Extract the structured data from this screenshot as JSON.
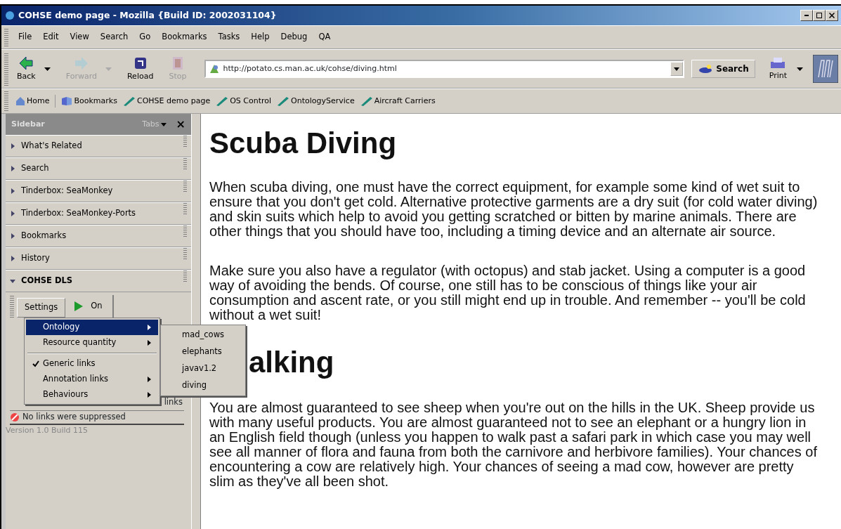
{
  "window": {
    "title": "COHSE demo page - Mozilla {Build ID: 2002031104}"
  },
  "menu_bar": [
    "File",
    "Edit",
    "View",
    "Search",
    "Go",
    "Bookmarks",
    "Tasks",
    "Help",
    "Debug",
    "QA"
  ],
  "toolbar": {
    "buttons": [
      {
        "label": "Back",
        "kind": "back",
        "disabled": false,
        "dropdown": true
      },
      {
        "label": "Forward",
        "kind": "forward",
        "disabled": true,
        "dropdown": true
      },
      {
        "label": "Reload",
        "kind": "reload",
        "disabled": false,
        "dropdown": false
      },
      {
        "label": "Stop",
        "kind": "stop",
        "disabled": true,
        "dropdown": false
      }
    ],
    "url": "http://potato.cs.man.ac.uk/cohse/diving.html",
    "search_button": "Search",
    "print_button": "Print"
  },
  "bookmarks_bar": [
    {
      "label": "Home",
      "kind": "home"
    },
    {
      "label": "Bookmarks",
      "kind": "bookmarks"
    },
    {
      "label": "COHSE demo page",
      "kind": "link"
    },
    {
      "label": "OS Control",
      "kind": "link"
    },
    {
      "label": "OntologyService",
      "kind": "link"
    },
    {
      "label": "Aircraft Carriers",
      "kind": "link"
    }
  ],
  "sidebar": {
    "title": "Sidebar",
    "tabs_label": "Tabs",
    "close": "×",
    "panels": [
      {
        "label": "What's Related",
        "expanded": false
      },
      {
        "label": "Search",
        "expanded": false
      },
      {
        "label": "Tinderbox: SeaMonkey",
        "expanded": false
      },
      {
        "label": "Tinderbox: SeaMonkey-Ports",
        "expanded": false
      },
      {
        "label": "Bookmarks",
        "expanded": false
      },
      {
        "label": "History",
        "expanded": false
      },
      {
        "label": "COHSE DLS",
        "expanded": true
      }
    ],
    "dls": {
      "settings_button": "Settings",
      "on_button": "On",
      "hidden_row_text": "links",
      "status": "No links were suppressed",
      "version": "Version 1.0 Build 115"
    }
  },
  "context_menu": {
    "items": [
      {
        "label": "Ontology",
        "kind": "submenu",
        "selected": true,
        "checked": false
      },
      {
        "label": "Resource quantity",
        "kind": "submenu",
        "selected": false,
        "checked": false
      },
      {
        "kind": "separator"
      },
      {
        "label": "Generic links",
        "kind": "check",
        "selected": false,
        "checked": true
      },
      {
        "label": "Annotation links",
        "kind": "submenu",
        "selected": false,
        "checked": false
      },
      {
        "label": "Behaviours",
        "kind": "submenu",
        "selected": false,
        "checked": false
      }
    ],
    "submenu": [
      "mad_cows",
      "elephants",
      "javav1.2",
      "diving"
    ]
  },
  "content": {
    "sections": [
      {
        "heading": "Scuba Diving",
        "paragraphs": [
          "When scuba diving, one must have the correct equipment, for example some kind of wet suit to ensure that you don't get cold. Alternative protective garments are a dry suit (for cold water diving) and skin suits which help to avoid you getting scratched or bitten by marine animals. There are other things that you should have too, including a timing device and an alternate air source.",
          "Make sure you also have a regulator (with octopus) and stab jacket. Using a computer is a good way of avoiding the bends. Of course, one still has to be conscious of things like your air consumption and ascent rate, or you still might end up in trouble. And remember -- you'll be cold without a wet suit!"
        ]
      },
      {
        "heading": "alking",
        "paragraphs": [
          "You are almost guaranteed to see sheep when you're out on the hills in the UK. Sheep provide us with many useful products. You are almost guaranteed not to see an elephant or a hungry lion in an English field though (unless you happen to walk past a safari park in which case you may well see all manner of flora and fauna from both the carnivore and herbivore families). Your chances of encountering a cow are relatively high. Your chances of seeing a mad cow, however are pretty slim as they've all been shot."
        ]
      }
    ]
  }
}
